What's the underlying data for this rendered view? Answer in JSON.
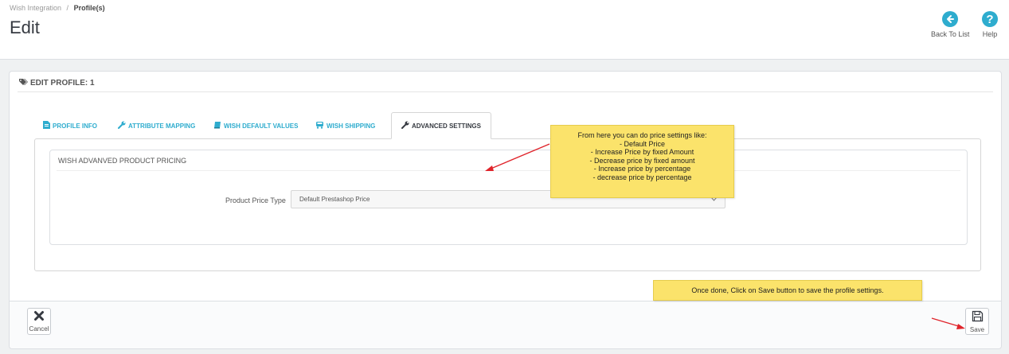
{
  "breadcrumb": {
    "parent": "Wish Integration",
    "separator": "/",
    "current": "Profile(s)"
  },
  "page": {
    "title": "Edit"
  },
  "toolbar": {
    "back_label": "Back To List",
    "help_label": "Help"
  },
  "panel": {
    "heading": "EDIT PROFILE: 1"
  },
  "tabs": [
    {
      "label": "PROFILE INFO",
      "icon": "file-icon"
    },
    {
      "label": "ATTRIBUTE MAPPING",
      "icon": "wrench-icon"
    },
    {
      "label": "WISH DEFAULT VALUES",
      "icon": "book-icon"
    },
    {
      "label": "WISH SHIPPING",
      "icon": "truck-icon"
    },
    {
      "label": "ADVANCED SETTINGS",
      "icon": "wrench-icon"
    }
  ],
  "pricing": {
    "heading": "WISH ADVANVED PRODUCT PRICING",
    "field_label": "Product Price Type",
    "selected_value": "Default Prestashop Price"
  },
  "footer": {
    "cancel_label": "Cancel",
    "save_label": "Save"
  },
  "annotations": {
    "pricing_title": "From here you can do price settings like:",
    "pricing_items": [
      "- Default Price",
      "- Increase Price by fixed Amount",
      "- Decrease price by fixed amount",
      "- Increase price by percentage",
      "- decrease price by percentage"
    ],
    "save_note": "Once done, Click on Save button to save the profile settings."
  },
  "colors": {
    "accent": "#2eacce",
    "note_bg": "#fbe36b",
    "arrow": "#e0242b"
  }
}
